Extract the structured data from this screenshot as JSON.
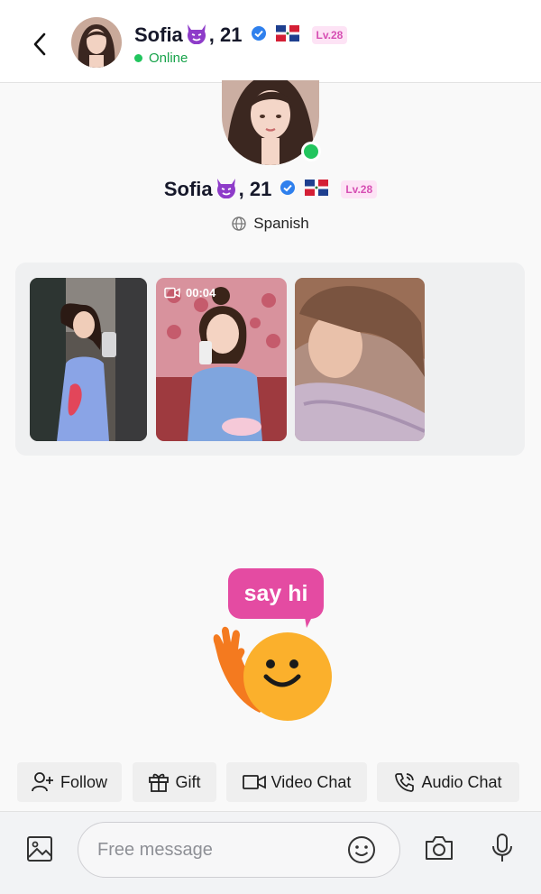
{
  "header": {
    "name": "Sofia",
    "age_suffix": ", 21",
    "status": "Online",
    "level": "Lv.28"
  },
  "profile": {
    "name": "Sofia",
    "age_suffix": ", 21",
    "level": "Lv.28",
    "language": "Spanish"
  },
  "media": [
    {
      "type": "photo"
    },
    {
      "type": "video",
      "duration": "00:04"
    },
    {
      "type": "photo"
    }
  ],
  "greeting": {
    "bubble_text": "say hi"
  },
  "actions": {
    "follow": "Follow",
    "gift": "Gift",
    "video_chat": "Video Chat",
    "audio_chat": "Audio Chat"
  },
  "composer": {
    "placeholder": "Free message"
  },
  "colors": {
    "online": "#22c55e",
    "level_badge_bg": "#fde3f5",
    "level_badge_text": "#d64fb3",
    "say_hi_bubble": "#e44ba2",
    "verified": "#2f80ed"
  }
}
